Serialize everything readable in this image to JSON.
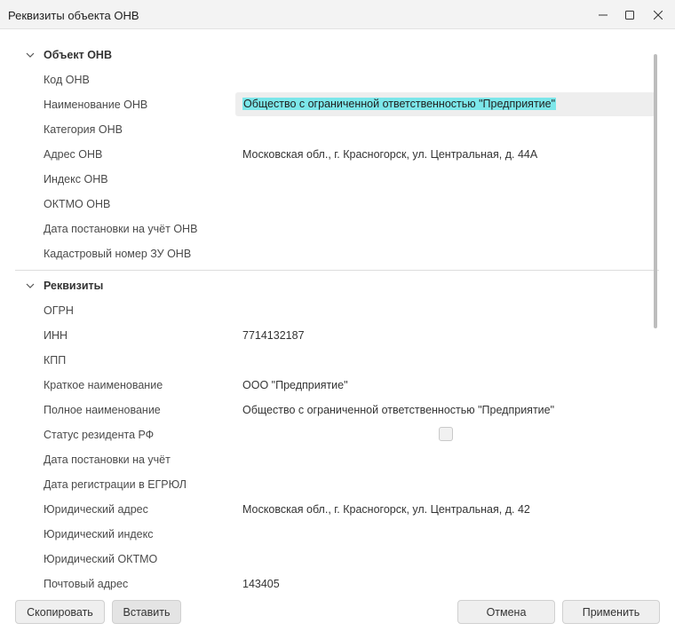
{
  "window": {
    "title": "Реквизиты объекта ОНВ"
  },
  "sections": [
    {
      "title": "Объект ОНВ",
      "rows": [
        {
          "label": "Код ОНВ",
          "value": ""
        },
        {
          "label": "Наименование ОНВ",
          "value": "Общество с ограниченной ответственностью \"Предприятие\""
        },
        {
          "label": "Категория ОНВ",
          "value": ""
        },
        {
          "label": "Адрес ОНВ",
          "value": "Московская обл., г. Красногорск, ул. Центральная, д. 44А"
        },
        {
          "label": "Индекс ОНВ",
          "value": ""
        },
        {
          "label": "ОКТМО ОНВ",
          "value": ""
        },
        {
          "label": "Дата постановки на учёт ОНВ",
          "value": ""
        },
        {
          "label": "Кадастровый номер ЗУ ОНВ",
          "value": ""
        }
      ]
    },
    {
      "title": "Реквизиты",
      "rows": [
        {
          "label": "ОГРН",
          "value": ""
        },
        {
          "label": "ИНН",
          "value": "7714132187"
        },
        {
          "label": "КПП",
          "value": ""
        },
        {
          "label": "Краткое наименование",
          "value": "ООО \"Предприятие\""
        },
        {
          "label": "Полное наименование",
          "value": "Общество с ограниченной ответственностью \"Предприятие\""
        },
        {
          "label": "Статус резидента РФ",
          "value": "",
          "checked": false
        },
        {
          "label": "Дата постановки на учёт",
          "value": ""
        },
        {
          "label": "Дата регистрации в ЕГРЮЛ",
          "value": ""
        },
        {
          "label": "Юридический адрес",
          "value": "Московская обл., г. Красногорск, ул. Центральная, д. 42"
        },
        {
          "label": "Юридический индекс",
          "value": ""
        },
        {
          "label": "Юридический ОКТМО",
          "value": ""
        },
        {
          "label": "Почтовый адрес",
          "value": "143405"
        }
      ]
    }
  ],
  "footer": {
    "copy_label": "Скопировать",
    "paste_label": "Вставить",
    "cancel_label": "Отмена",
    "apply_label": "Применить"
  }
}
